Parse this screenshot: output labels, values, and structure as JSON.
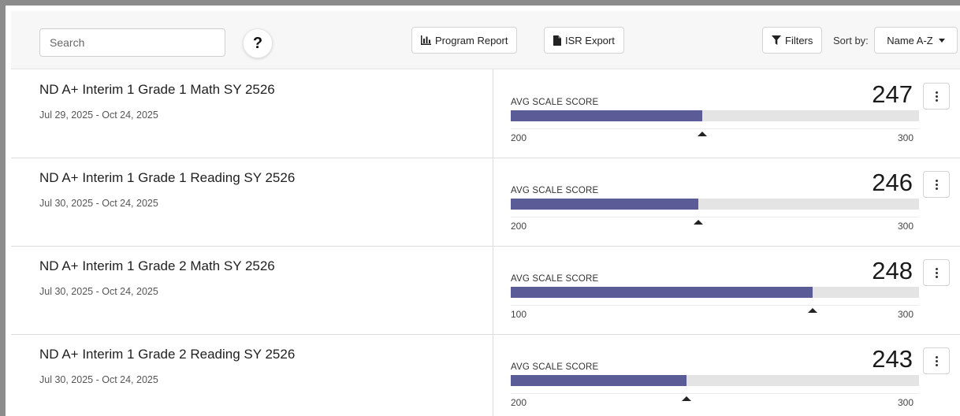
{
  "toolbar": {
    "search_placeholder": "Search",
    "help_label": "?",
    "program_report_label": "Program Report",
    "isr_export_label": "ISR Export",
    "filters_label": "Filters",
    "sort_label": "Sort by:",
    "sort_value": "Name A-Z"
  },
  "colors": {
    "bar_fill": "#5b5b98",
    "bar_track": "#e4e4e4"
  },
  "rows": [
    {
      "title": "ND A+ Interim 1 Grade 1 Math SY 2526",
      "dates": "Jul 29, 2025 - Oct 24, 2025",
      "score_label": "AVG SCALE SCORE",
      "score": 247,
      "min": 200,
      "max": 300
    },
    {
      "title": "ND A+ Interim 1 Grade 1 Reading SY 2526",
      "dates": "Jul 30, 2025 - Oct 24, 2025",
      "score_label": "AVG SCALE SCORE",
      "score": 246,
      "min": 200,
      "max": 300
    },
    {
      "title": "ND A+ Interim 1 Grade 2 Math SY 2526",
      "dates": "Jul 30, 2025 - Oct 24, 2025",
      "score_label": "AVG SCALE SCORE",
      "score": 248,
      "min": 100,
      "max": 300
    },
    {
      "title": "ND A+ Interim 1 Grade 2 Reading SY 2526",
      "dates": "Jul 30, 2025 - Oct 24, 2025",
      "score_label": "AVG SCALE SCORE",
      "score": 243,
      "min": 200,
      "max": 300
    }
  ]
}
